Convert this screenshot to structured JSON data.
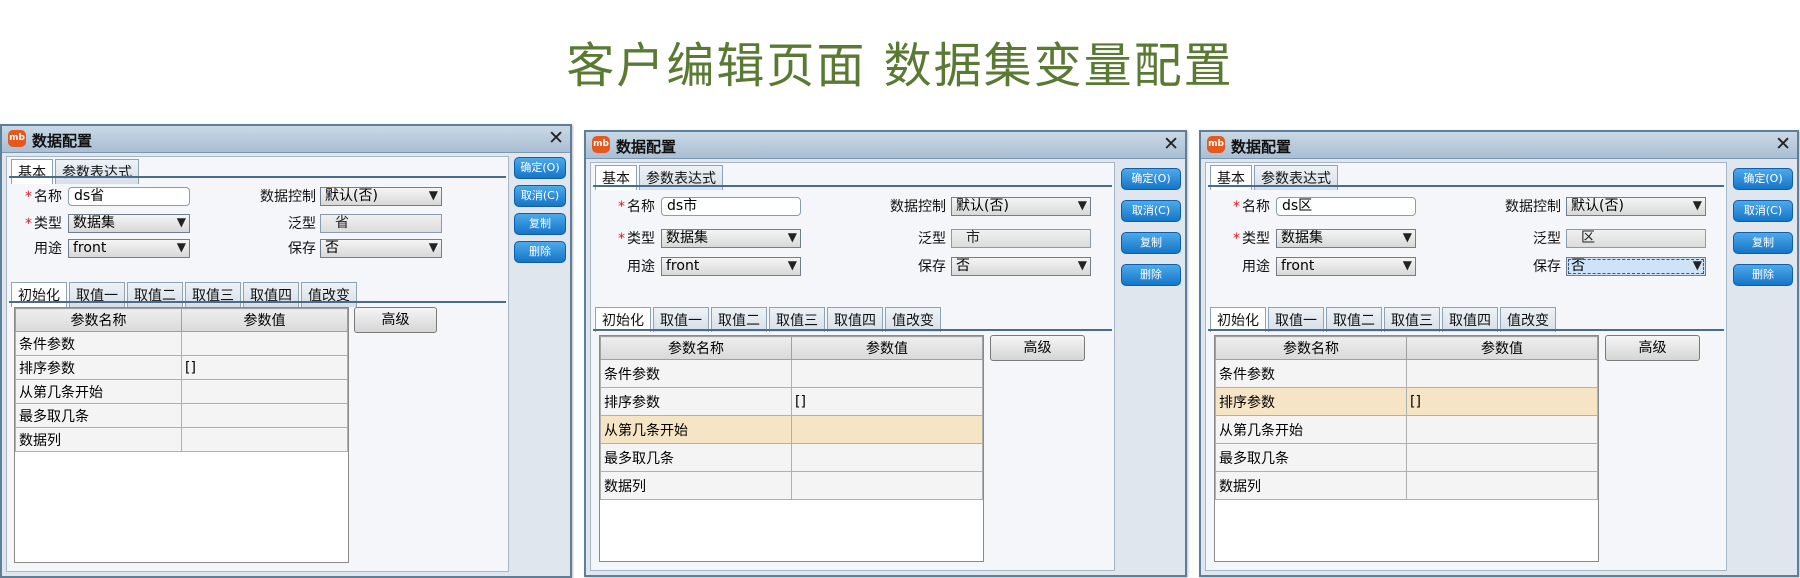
{
  "page_title": "客户编辑页面  数据集变量配置",
  "colors": {
    "title_green": "#5a7a34",
    "required_red": "#d52020",
    "button_blue": "#1575c8",
    "row_highlight": "#f5e5c4"
  },
  "icons": {
    "app": "app-logo-icon",
    "close": "close-icon",
    "dropdown": "chevron-down-icon"
  },
  "dialogs": [
    {
      "window_title": "数据配置",
      "app_icon": "mb",
      "close_glyph": "✕",
      "tabs": [
        "基本",
        "参数表达式"
      ],
      "fields": {
        "name_label": "名称",
        "name_value": "ds省",
        "type_label": "类型",
        "type_value": "数据集",
        "use_label": "用途",
        "use_value": "front",
        "datactrl_label": "数据控制",
        "datactrl_value": "默认(否)",
        "generic_label": "泛型",
        "generic_value": "省",
        "save_label": "保存",
        "save_value": "否",
        "required_mark": "*"
      },
      "buttons": {
        "ok": "确定(O)",
        "cancel": "取消(C)",
        "copy": "复制",
        "delete": "删除"
      },
      "subtabs": [
        "初始化",
        "取值一",
        "取值二",
        "取值三",
        "取值四",
        "值改变"
      ],
      "grid": {
        "headers": [
          "参数名称",
          "参数值"
        ],
        "rows": [
          [
            "条件参数",
            ""
          ],
          [
            "排序参数",
            "[]"
          ],
          [
            "从第几条开始",
            ""
          ],
          [
            "最多取几条",
            ""
          ],
          [
            "数据列",
            ""
          ]
        ]
      },
      "advanced_label": "高级"
    },
    {
      "window_title": "数据配置",
      "app_icon": "mb",
      "close_glyph": "✕",
      "tabs": [
        "基本",
        "参数表达式"
      ],
      "fields": {
        "name_label": "名称",
        "name_value": "ds市",
        "type_label": "类型",
        "type_value": "数据集",
        "use_label": "用途",
        "use_value": "front",
        "datactrl_label": "数据控制",
        "datactrl_value": "默认(否)",
        "generic_label": "泛型",
        "generic_value": "市",
        "save_label": "保存",
        "save_value": "否",
        "required_mark": "*"
      },
      "buttons": {
        "ok": "确定(O)",
        "cancel": "取消(C)",
        "copy": "复制",
        "delete": "删除"
      },
      "subtabs": [
        "初始化",
        "取值一",
        "取值二",
        "取值三",
        "取值四",
        "值改变"
      ],
      "grid": {
        "headers": [
          "参数名称",
          "参数值"
        ],
        "rows": [
          [
            "条件参数",
            ""
          ],
          [
            "排序参数",
            "[]"
          ],
          [
            "从第几条开始",
            ""
          ],
          [
            "最多取几条",
            ""
          ],
          [
            "数据列",
            ""
          ]
        ],
        "highlighted_row": 2
      },
      "advanced_label": "高级"
    },
    {
      "window_title": "数据配置",
      "app_icon": "mb",
      "close_glyph": "✕",
      "tabs": [
        "基本",
        "参数表达式"
      ],
      "fields": {
        "name_label": "名称",
        "name_value": "ds区",
        "type_label": "类型",
        "type_value": "数据集",
        "use_label": "用途",
        "use_value": "front",
        "datactrl_label": "数据控制",
        "datactrl_value": "默认(否)",
        "generic_label": "泛型",
        "generic_value": "区",
        "save_label": "保存",
        "save_value": "否",
        "required_mark": "*"
      },
      "buttons": {
        "ok": "确定(O)",
        "cancel": "取消(C)",
        "copy": "复制",
        "delete": "删除"
      },
      "subtabs": [
        "初始化",
        "取值一",
        "取值二",
        "取值三",
        "取值四",
        "值改变"
      ],
      "grid": {
        "headers": [
          "参数名称",
          "参数值"
        ],
        "rows": [
          [
            "条件参数",
            ""
          ],
          [
            "排序参数",
            "[]"
          ],
          [
            "从第几条开始",
            ""
          ],
          [
            "最多取几条",
            ""
          ],
          [
            "数据列",
            ""
          ]
        ],
        "highlighted_row": 1
      },
      "advanced_label": "高级"
    }
  ]
}
